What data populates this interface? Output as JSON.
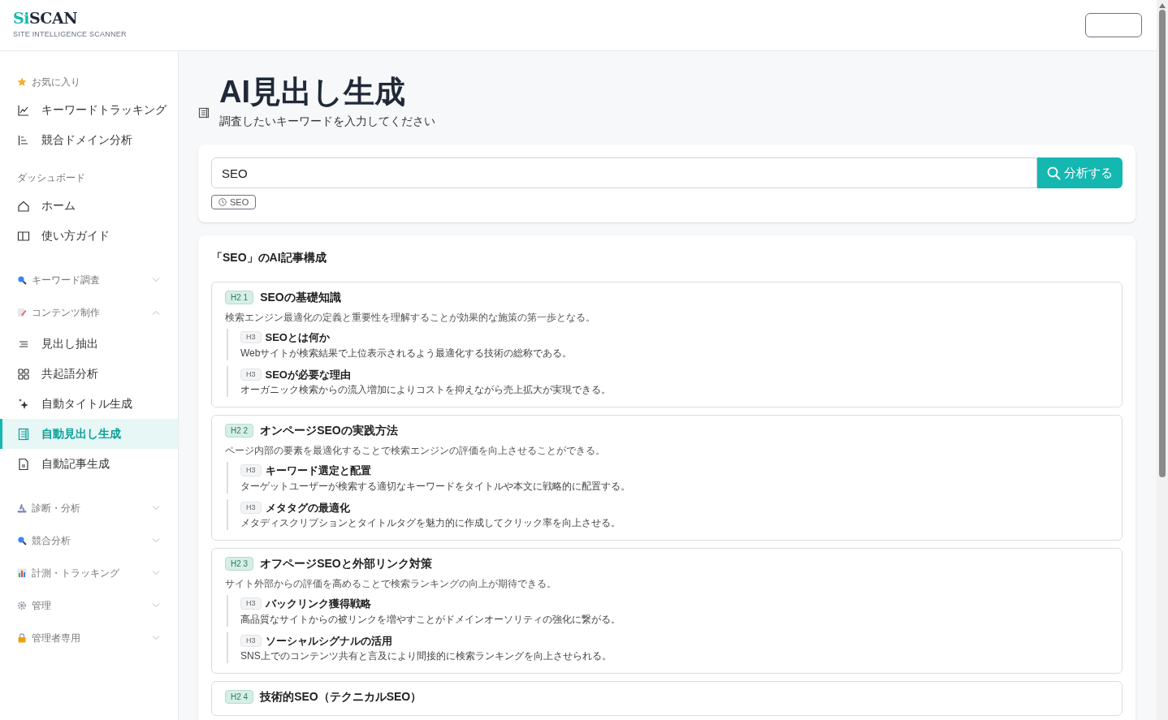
{
  "brand": {
    "logo_accent": "Si",
    "logo_rest": "SCAN",
    "tagline": "SITE INTELLIGENCE SCANNER"
  },
  "sidebar": {
    "sections": [
      {
        "kind": "group",
        "label": "お気に入り",
        "items": [
          {
            "label": "キーワードトラッキング",
            "selected": false
          },
          {
            "label": "競合ドメイン分析",
            "selected": false
          }
        ]
      },
      {
        "kind": "group",
        "label": "ダッシュボード",
        "items": [
          {
            "label": "ホーム",
            "selected": false
          },
          {
            "label": "使い方ガイド",
            "selected": false
          }
        ]
      },
      {
        "kind": "collapsible",
        "label": "キーワード調査",
        "expanded": false
      },
      {
        "kind": "collapsible",
        "label": "コンテンツ制作",
        "expanded": true,
        "items": [
          {
            "label": "見出し抽出",
            "selected": false
          },
          {
            "label": "共起語分析",
            "selected": false
          },
          {
            "label": "自動タイトル生成",
            "selected": false
          },
          {
            "label": "自動見出し生成",
            "selected": true
          },
          {
            "label": "自動記事生成",
            "selected": false
          }
        ]
      },
      {
        "kind": "collapsible",
        "label": "診断・分析",
        "expanded": false
      },
      {
        "kind": "collapsible",
        "label": "競合分析",
        "expanded": false
      },
      {
        "kind": "collapsible",
        "label": "計測・トラッキング",
        "expanded": false
      },
      {
        "kind": "collapsible",
        "label": "管理",
        "expanded": false
      },
      {
        "kind": "collapsible",
        "label": "管理者専用",
        "expanded": false
      }
    ]
  },
  "page": {
    "title": "AI見出し生成",
    "subtitle": "調査したいキーワードを入力してください"
  },
  "search": {
    "value": "SEO",
    "button": "分析する",
    "history": [
      "SEO"
    ]
  },
  "outline": {
    "title": "「SEO」のAI記事構成",
    "sections": [
      {
        "tag": "H2 1",
        "title": "SEOの基礎知識",
        "summary": "検索エンジン最適化の定義と重要性を理解することが効果的な施策の第一歩となる。",
        "children": [
          {
            "tag": "H3",
            "title": "SEOとは何か",
            "summary": "Webサイトが検索結果で上位表示されるよう最適化する技術の総称である。"
          },
          {
            "tag": "H3",
            "title": "SEOが必要な理由",
            "summary": "オーガニック検索からの流入増加によりコストを抑えながら売上拡大が実現できる。"
          }
        ]
      },
      {
        "tag": "H2 2",
        "title": "オンページSEOの実践方法",
        "summary": "ページ内部の要素を最適化することで検索エンジンの評価を向上させることができる。",
        "children": [
          {
            "tag": "H3",
            "title": "キーワード選定と配置",
            "summary": "ターゲットユーザーが検索する適切なキーワードをタイトルや本文に戦略的に配置する。"
          },
          {
            "tag": "H3",
            "title": "メタタグの最適化",
            "summary": "メタディスクリプションとタイトルタグを魅力的に作成してクリック率を向上させる。"
          }
        ]
      },
      {
        "tag": "H2 3",
        "title": "オフページSEOと外部リンク対策",
        "summary": "サイト外部からの評価を高めることで検索ランキングの向上が期待できる。",
        "children": [
          {
            "tag": "H3",
            "title": "バックリンク獲得戦略",
            "summary": "高品質なサイトからの被リンクを増やすことがドメインオーソリティの強化に繋がる。"
          },
          {
            "tag": "H3",
            "title": "ソーシャルシグナルの活用",
            "summary": "SNS上でのコンテンツ共有と言及により間接的に検索ランキングを向上させられる。"
          }
        ]
      },
      {
        "tag": "H2 4",
        "title": "技術的SEO（テクニカルSEO）"
      }
    ]
  }
}
